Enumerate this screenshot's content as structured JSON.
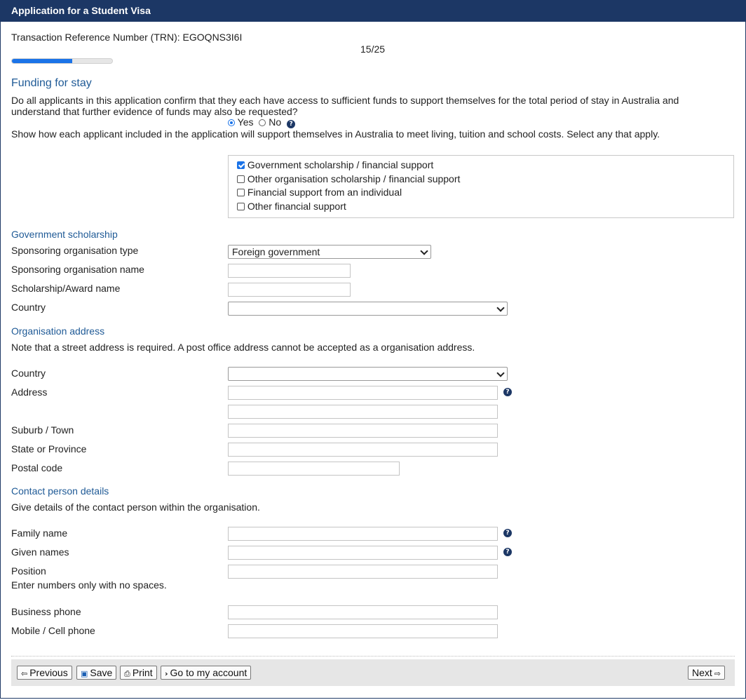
{
  "window": {
    "title": "Application for a Student Visa"
  },
  "header": {
    "trn_label": "Transaction Reference Number (TRN): EGOQNS3I6I",
    "page_counter": "15/25",
    "progress_fraction": 0.6
  },
  "funding": {
    "title": "Funding for stay",
    "question_line1": "Do all applicants in this application confirm that they each have access to sufficient funds to support themselves for the total period of stay in Australia and",
    "question_line2": "understand that further evidence of funds may also be requested?",
    "yes_label": "Yes",
    "no_label": "No",
    "selected": "Yes",
    "show_how": "Show how each applicant included in the application will support themselves in Australia to meet living, tuition and school costs. Select any that apply.",
    "options": [
      {
        "label": "Government scholarship / financial support",
        "checked": true
      },
      {
        "label": "Other organisation scholarship / financial support",
        "checked": false
      },
      {
        "label": "Financial support from an individual",
        "checked": false
      },
      {
        "label": "Other financial support",
        "checked": false
      }
    ]
  },
  "government": {
    "title": "Government scholarship",
    "org_type_label": "Sponsoring organisation type",
    "org_type_value": "Foreign government",
    "org_name_label": "Sponsoring organisation name",
    "award_label": "Scholarship/Award name",
    "country_label": "Country",
    "country_value": ""
  },
  "address": {
    "title": "Organisation address",
    "note": "Note that a street address is required. A post office address cannot be accepted as a organisation address.",
    "country_label": "Country",
    "address_label": "Address",
    "suburb_label": "Suburb / Town",
    "state_label": "State or Province",
    "postal_label": "Postal code"
  },
  "contact": {
    "title": "Contact person details",
    "note": "Give details of the contact person within the organisation.",
    "family_label": "Family name",
    "given_label": "Given names",
    "position_label": "Position",
    "numbers_note": "Enter numbers only with no spaces.",
    "business_label": "Business phone",
    "mobile_label": "Mobile / Cell phone"
  },
  "footer": {
    "previous": "Previous",
    "save": "Save",
    "print": "Print",
    "account": "Go to my account",
    "next": "Next"
  },
  "icons": {
    "help": "question-circle-icon"
  },
  "colors": {
    "header_bg": "#1c3765",
    "heading": "#1f5a96",
    "accent": "#1a73e8"
  }
}
